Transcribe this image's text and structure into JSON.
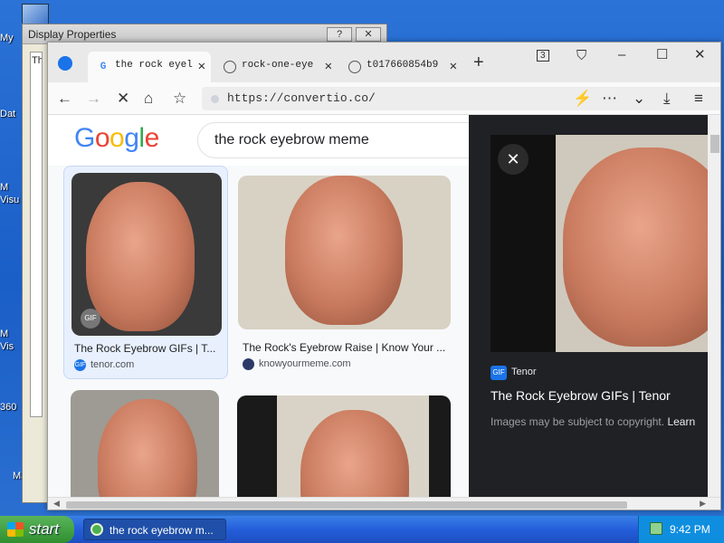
{
  "desktop": {
    "icons": [
      {
        "label": "My",
        "icon": "computer-icon"
      },
      {
        "label": "Dat",
        "icon": "folder-icon"
      },
      {
        "label": "M\nVisu",
        "icon": "app-icon"
      },
      {
        "label": "M\nVis",
        "icon": "app-icon"
      },
      {
        "label": "360",
        "icon": "app-icon"
      },
      {
        "label": "MagicB",
        "icon": "folder-icon"
      }
    ]
  },
  "display_properties": {
    "title": "Display Properties",
    "help_label": "?",
    "close_label": "✕",
    "left_text": "Th"
  },
  "browser": {
    "tabs": [
      {
        "label": "the rock eyel",
        "favicon": "google-icon",
        "active": true
      },
      {
        "label": "rock-one-eye",
        "favicon": "globe-icon",
        "active": false
      },
      {
        "label": "t017660854b9",
        "favicon": "globe-icon",
        "active": false
      }
    ],
    "tab_count": "3",
    "address": "https://convertio.co/",
    "colors": {
      "accent": "#1a73e8",
      "tab_active": "#fafafa"
    }
  },
  "google": {
    "logo_letters": [
      {
        "ch": "G",
        "color": "#4285F4"
      },
      {
        "ch": "o",
        "color": "#EA4335"
      },
      {
        "ch": "o",
        "color": "#FBBC05"
      },
      {
        "ch": "g",
        "color": "#4285F4"
      },
      {
        "ch": "l",
        "color": "#34A853"
      },
      {
        "ch": "e",
        "color": "#EA4335"
      }
    ],
    "query": "the rock eyebrow meme",
    "results": [
      {
        "title": "The Rock Eyebrow GIFs | T...",
        "site": "tenor.com",
        "badge": "GIF"
      },
      {
        "title": "The Rock's Eyebrow Raise | Know Your ...",
        "site": "knowyourmeme.com",
        "badge": ""
      }
    ],
    "preview": {
      "source": "Tenor",
      "source_badge": "GIF",
      "title": "The Rock Eyebrow GIFs | Tenor",
      "note": "Images may be subject to copyright.",
      "learn": "Learn"
    }
  },
  "taskbar": {
    "start_label": "start",
    "task_label": "the rock eyebrow m...",
    "clock": "9:42 PM"
  }
}
